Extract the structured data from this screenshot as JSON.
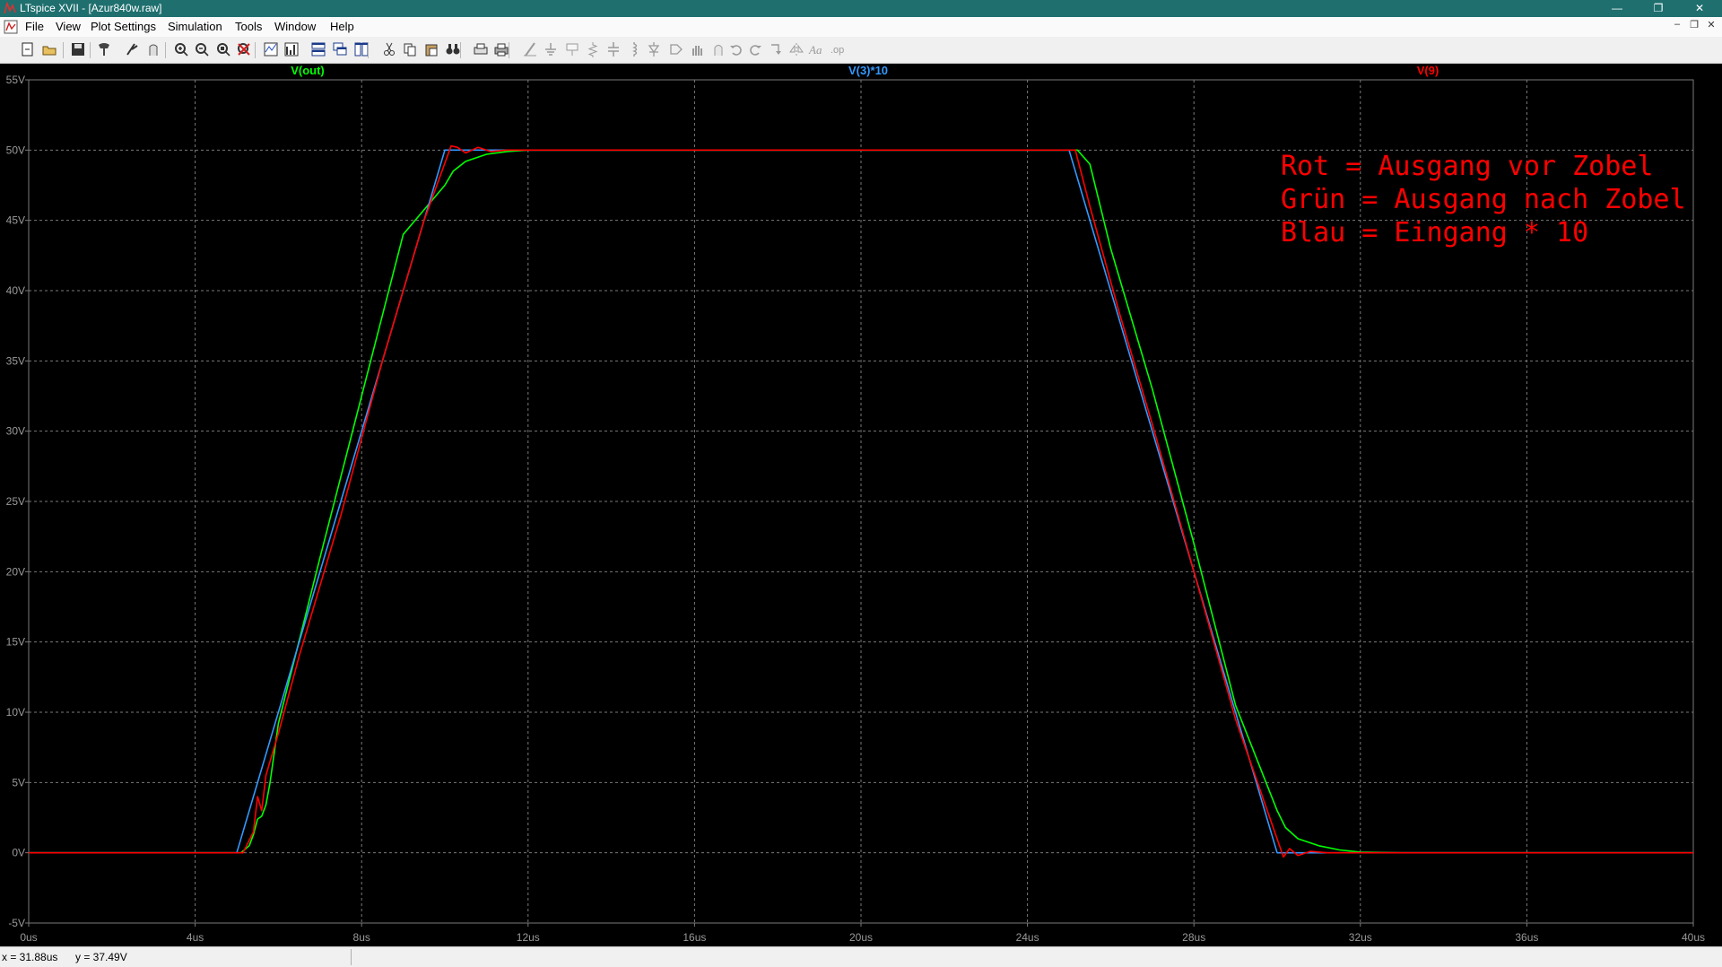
{
  "window": {
    "title": "LTspice XVII - [Azur840w.raw]",
    "minimize": "—",
    "restore": "❐",
    "close": "✕"
  },
  "menu": {
    "items": [
      "File",
      "View",
      "Plot Settings",
      "Simulation",
      "Tools",
      "Window",
      "Help"
    ],
    "mdi_buttons": [
      "–",
      "❐",
      "✕"
    ]
  },
  "toolbar": {
    "icons": [
      "new-schematic-icon",
      "open-icon",
      "save-icon",
      "control-panel-icon",
      "run-icon",
      "halt-icon",
      "zoom-in-icon",
      "zoom-out-icon",
      "zoom-full-icon",
      "zoom-cancel-icon",
      "autorange-icon",
      "fft-icon",
      "tile-horizontal-icon",
      "cascade-icon",
      "tile-vertical-icon",
      "cut-icon",
      "copy-icon",
      "paste-icon",
      "find-icon",
      "print-setup-icon",
      "print-icon",
      "wire-icon",
      "ground-icon",
      "label-icon",
      "resistor-icon",
      "capacitor-icon",
      "inductor-icon",
      "diode-icon",
      "component-icon",
      "move-icon",
      "drag-icon",
      "undo-icon",
      "redo-icon",
      "rotate-icon",
      "mirror-icon",
      "text-icon",
      "spice-directive-icon"
    ]
  },
  "status": {
    "x": "x = 31.88us",
    "y": "y = 37.49V"
  },
  "colors": {
    "plot_bg": "#000000",
    "grid": "#7a7a7a",
    "axis_label": "#9a9a9a",
    "v_out": "#00ff00",
    "v3x10": "#3399ff",
    "v9": "#ff0000",
    "annotation": "#ff0000"
  },
  "chart_data": {
    "type": "line",
    "xlabel": "",
    "ylabel": "",
    "xlim": [
      0,
      40
    ],
    "ylim": [
      -5,
      55
    ],
    "x_unit": "us",
    "y_unit": "V",
    "grid": true,
    "legend_position": "top",
    "x_ticks": [
      "0us",
      "4us",
      "8us",
      "12us",
      "16us",
      "20us",
      "24us",
      "28us",
      "32us",
      "36us",
      "40us"
    ],
    "y_ticks": [
      "55V",
      "50V",
      "45V",
      "40V",
      "35V",
      "30V",
      "25V",
      "20V",
      "15V",
      "10V",
      "5V",
      "0V",
      "-5V"
    ],
    "series": [
      {
        "name": "V(out)",
        "color": "#00ff00",
        "x": [
          0,
          5.1,
          5.3,
          5.4,
          5.5,
          5.6,
          5.7,
          5.8,
          6.0,
          7.0,
          8.0,
          9.0,
          10.0,
          10.2,
          10.5,
          11.0,
          11.5,
          12.0,
          12.8,
          20,
          25.2,
          25.5,
          26,
          27,
          28,
          29,
          30.0,
          30.2,
          30.5,
          31.0,
          31.5,
          32.0,
          33.0,
          40
        ],
        "y": [
          0,
          0,
          0.5,
          1.3,
          2.4,
          2.6,
          3.4,
          5.0,
          9.2,
          21.0,
          32.5,
          44.0,
          47.5,
          48.5,
          49.2,
          49.7,
          49.9,
          50,
          50,
          50,
          50,
          49.0,
          43.0,
          33.0,
          22.0,
          10.5,
          3.0,
          1.8,
          1.0,
          0.5,
          0.2,
          0.05,
          0,
          0
        ]
      },
      {
        "name": "V(3)*10",
        "color": "#3399ff",
        "x": [
          0,
          5.0,
          10.0,
          25.0,
          30.0,
          40
        ],
        "y": [
          0,
          0,
          50,
          50,
          0,
          0
        ]
      },
      {
        "name": "V(9)",
        "color": "#ff0000",
        "x": [
          0,
          5.15,
          5.4,
          5.5,
          5.6,
          5.7,
          5.8,
          6.0,
          6.5,
          7.5,
          8.5,
          9.5,
          10.15,
          10.3,
          10.5,
          10.8,
          11.1,
          11.5,
          20,
          25.15,
          25.5,
          26.2,
          27,
          28,
          29,
          30.15,
          30.3,
          30.5,
          30.8,
          31.2,
          40
        ],
        "y": [
          0,
          0,
          1.5,
          4.0,
          3.0,
          5.5,
          6.5,
          8.5,
          14.0,
          24.0,
          35.0,
          45.0,
          50.3,
          50.2,
          49.8,
          50.2,
          49.9,
          50,
          50,
          50,
          46.0,
          38.5,
          30.5,
          20.0,
          9.5,
          -0.3,
          0.3,
          -0.2,
          0.1,
          0,
          0
        ]
      }
    ],
    "annotations": [
      "Rot = Ausgang vor Zobel",
      "Grün = Ausgang nach Zobel",
      "Blau = Eingang * 10"
    ]
  }
}
